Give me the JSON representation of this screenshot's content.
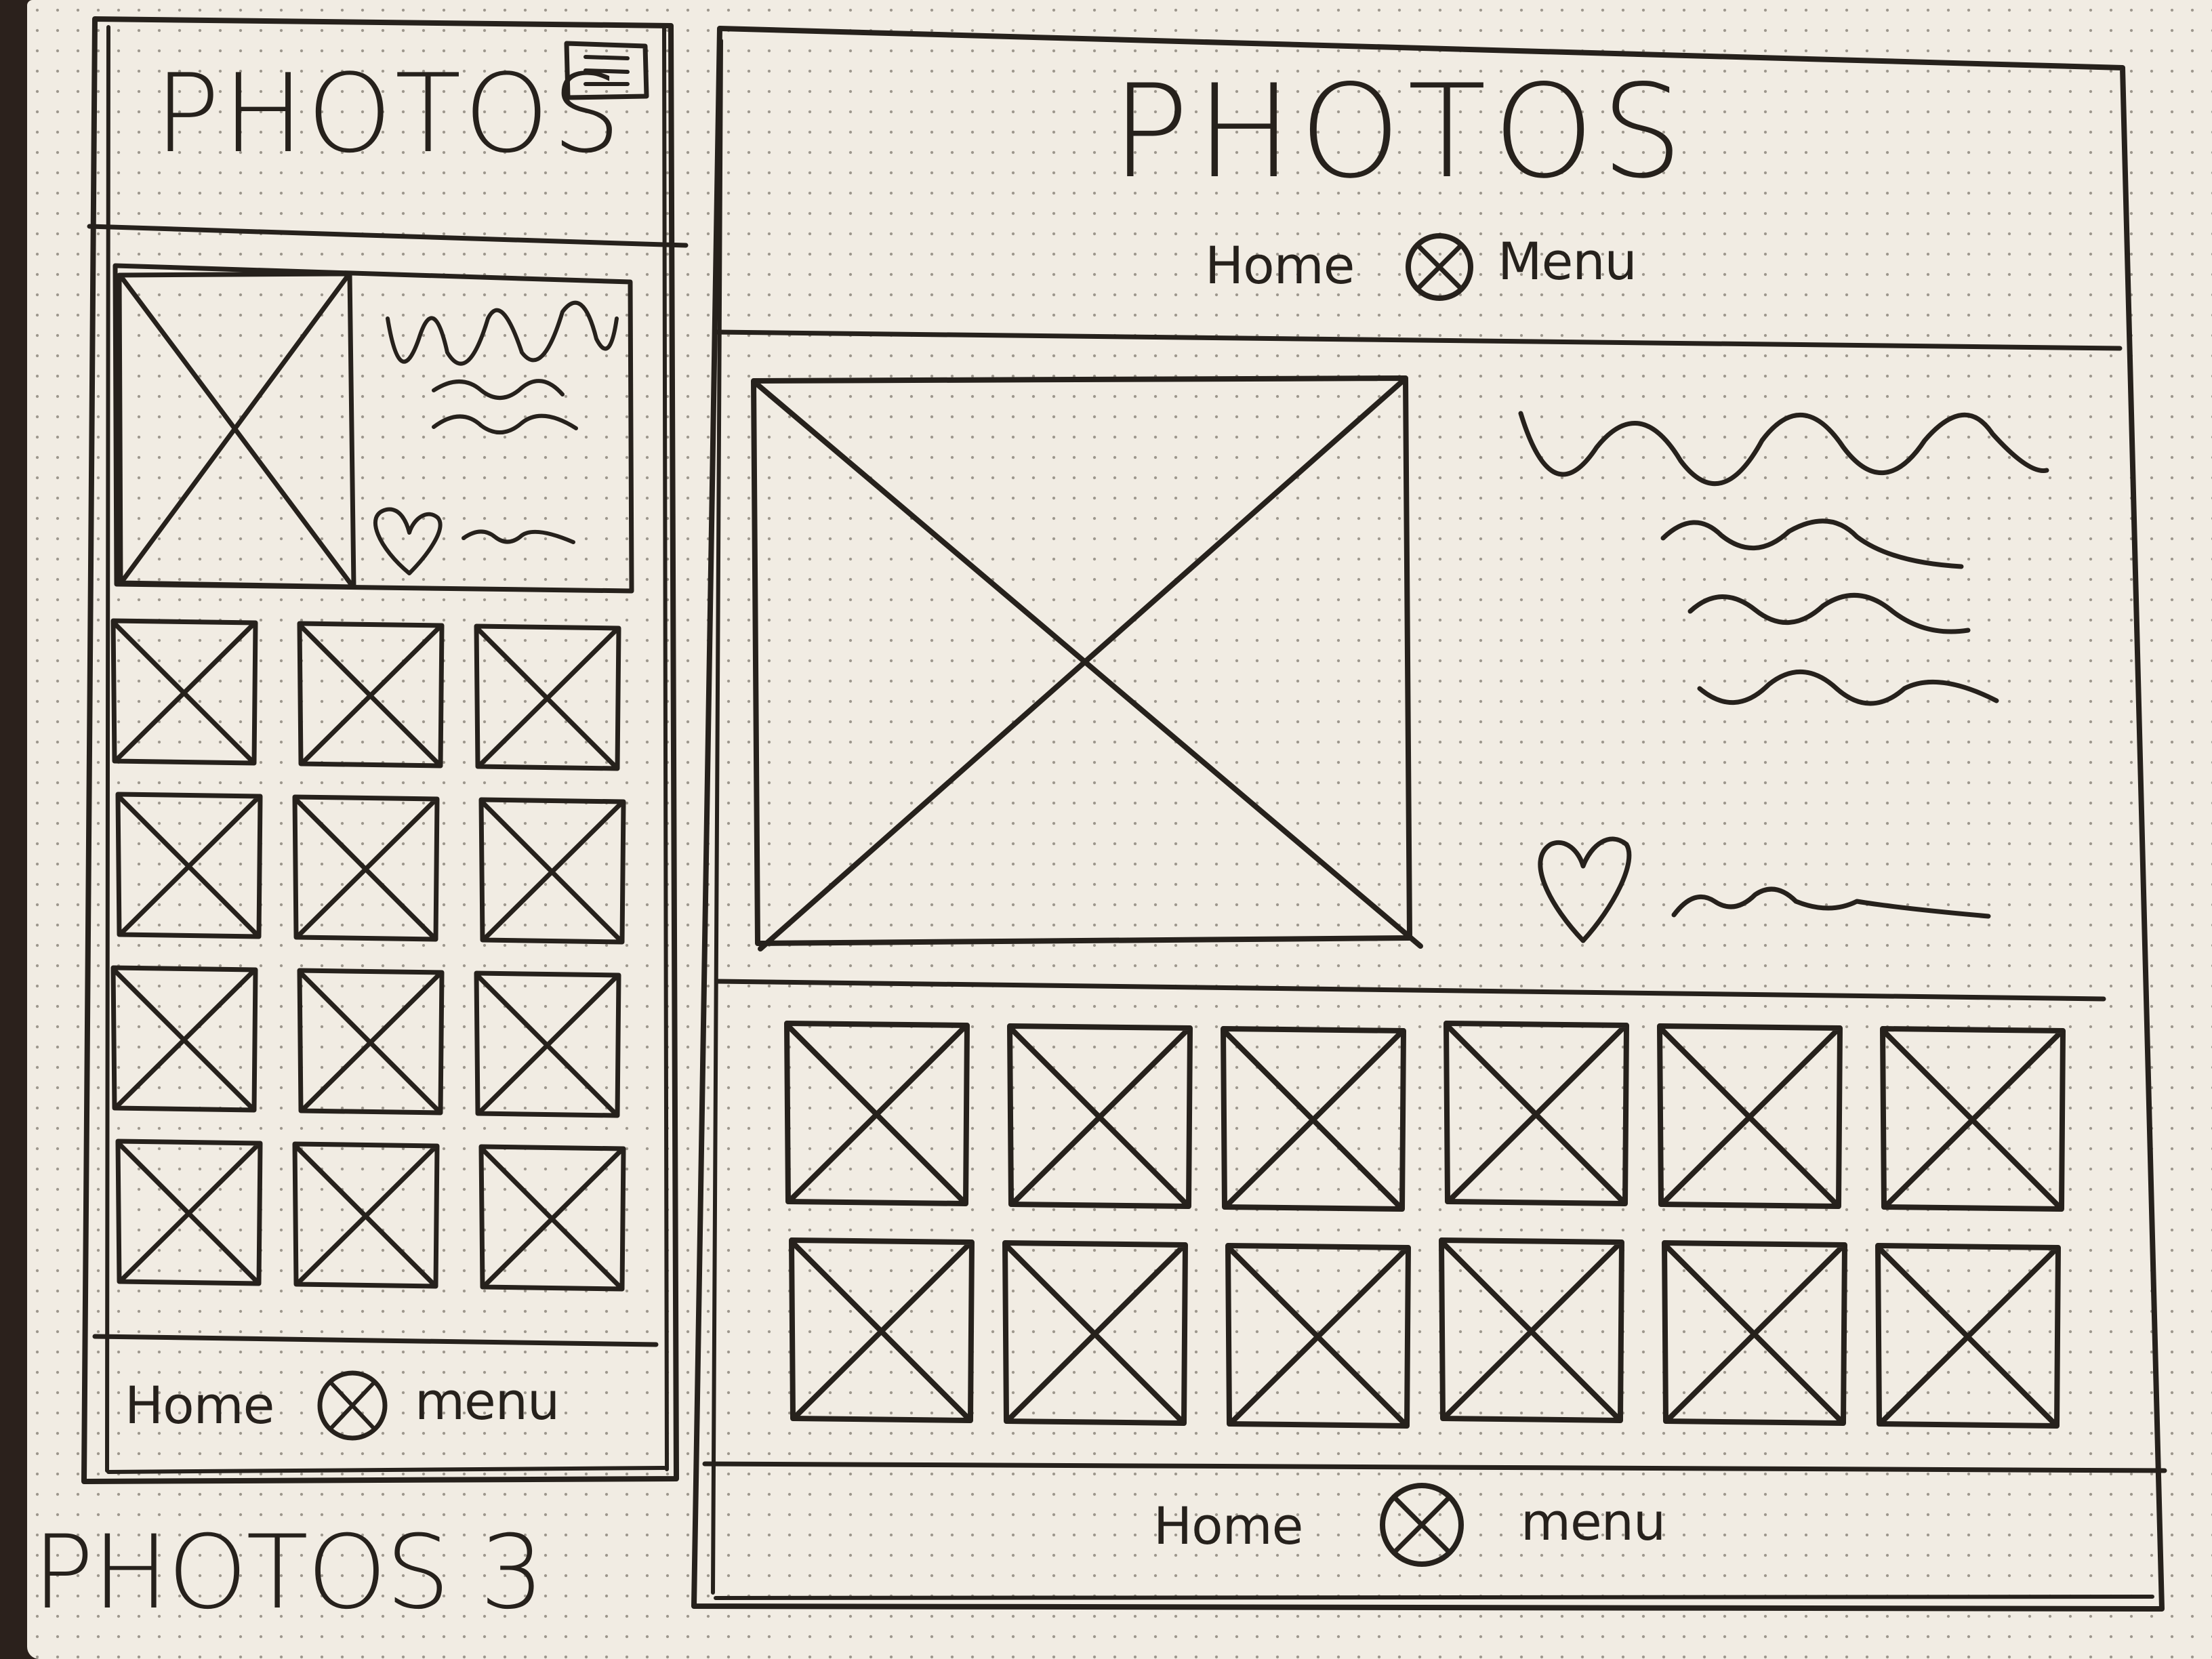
{
  "mobile": {
    "title": "PHOTOS",
    "menu_icon": "hamburger-menu-icon",
    "featured": {
      "image_icon": "image-placeholder-icon",
      "like_icon": "heart-icon"
    },
    "grid": {
      "rows": 4,
      "cols": 3
    },
    "footer": {
      "home_label": "Home",
      "menu_icon": "circle-x-icon",
      "menu_label": "menu"
    }
  },
  "desktop": {
    "title": "PHOTOS",
    "nav": {
      "home_label": "Home",
      "menu_icon": "circle-x-icon",
      "menu_label": "Menu"
    },
    "featured": {
      "image_icon": "image-placeholder-icon",
      "like_icon": "heart-icon"
    },
    "grid": {
      "rows": 2,
      "cols": 6
    },
    "footer": {
      "home_label": "Home",
      "menu_icon": "circle-x-icon",
      "menu_label": "menu"
    }
  },
  "sheet_label": "PHOTOS 3"
}
